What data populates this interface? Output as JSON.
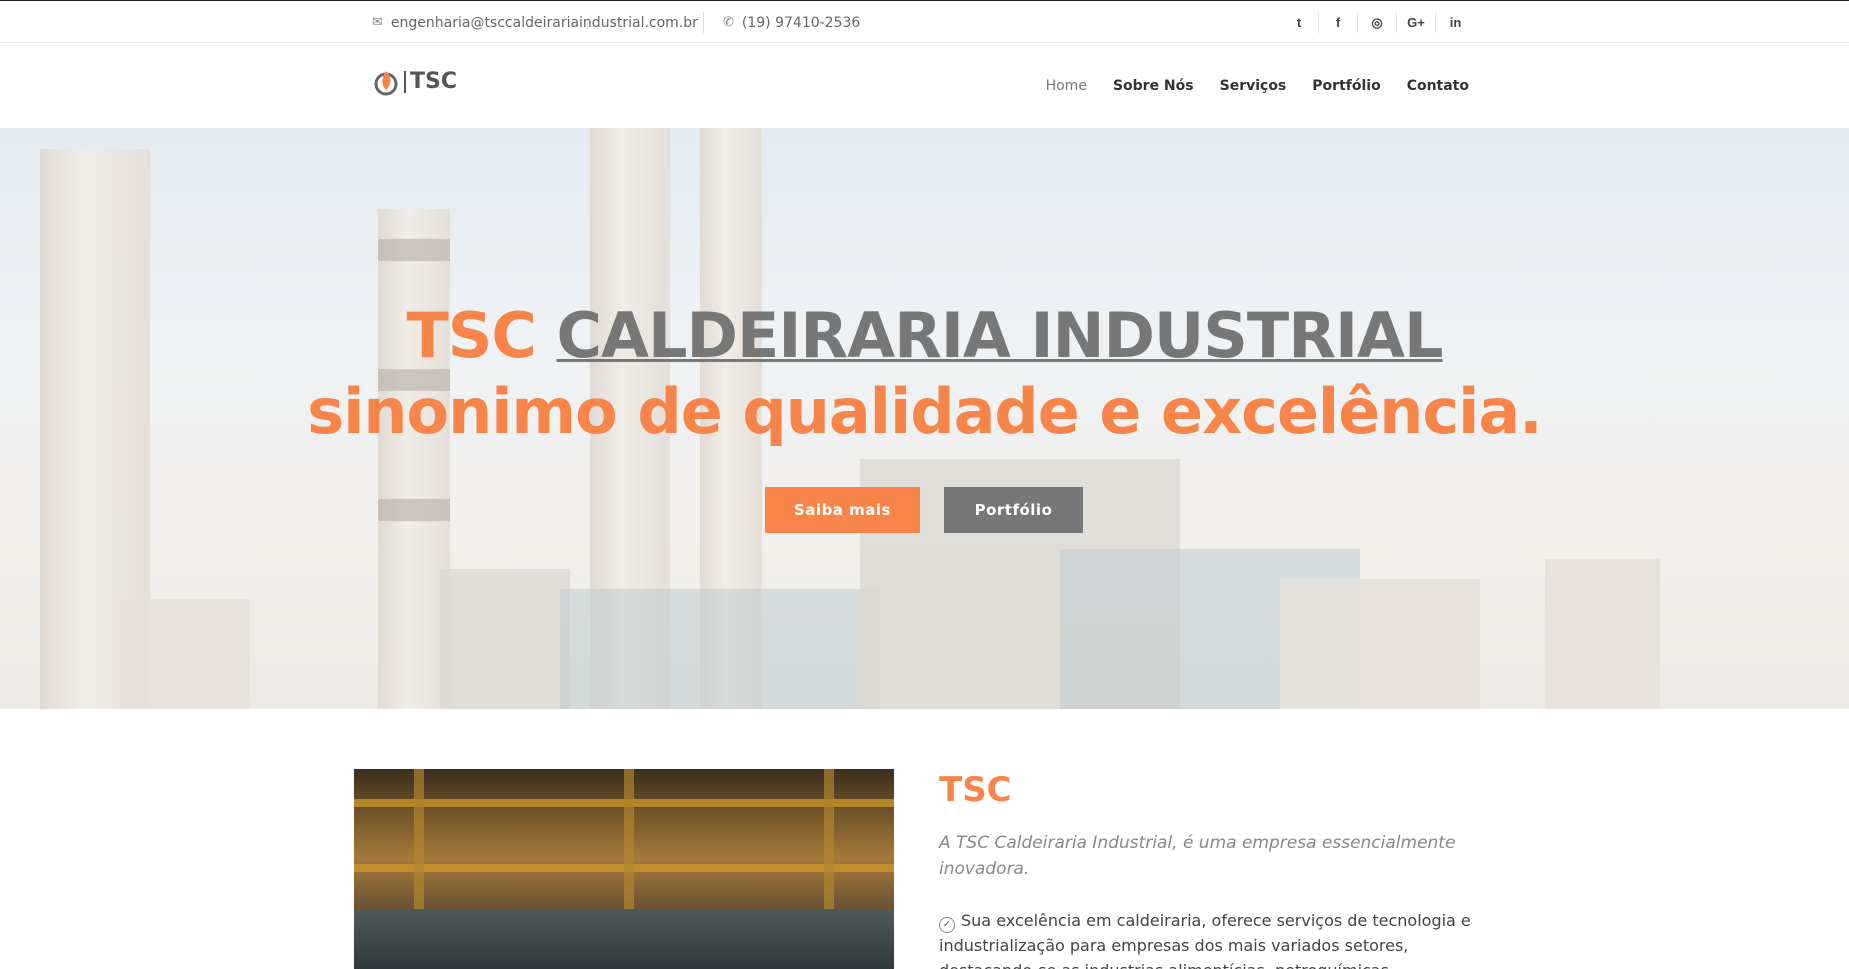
{
  "topbar": {
    "email": "engenharia@tsccaldeirariaindustrial.com.br",
    "phone": "(19) 97410-2536",
    "email_icon": "envelope-icon",
    "phone_icon": "phone-icon",
    "socials": [
      {
        "name": "twitter-icon",
        "glyph": "t"
      },
      {
        "name": "facebook-icon",
        "glyph": "f"
      },
      {
        "name": "instagram-icon",
        "glyph": "◎"
      },
      {
        "name": "google-plus-icon",
        "glyph": "G+"
      },
      {
        "name": "linkedin-icon",
        "glyph": "in"
      }
    ]
  },
  "header": {
    "logo_text": "TSC",
    "nav": [
      "Home",
      "Sobre Nós",
      "Serviços",
      "Portfólio",
      "Contato"
    ],
    "active_nav": "Home"
  },
  "hero": {
    "title_brand": "TSC",
    "title_name": "CALDEIRARIA INDUSTRIAL",
    "title_line2": "sinonimo de qualidade e excelência.",
    "btn_primary": "Saiba mais",
    "btn_secondary": "Portfólio"
  },
  "about": {
    "title": "TSC",
    "lead": "A TSC Caldeiraria Industrial, é uma empresa essencialmente inovadora.",
    "item": "Sua excelência em caldeiraria, oferece serviços de tecnologia e industrialização para empresas dos mais variados setores, destacando-se as industrias alimentícias, petroquímicas, farmacêutica, químicas e"
  },
  "colors": {
    "accent": "#f7854a",
    "secondary": "#777777"
  }
}
